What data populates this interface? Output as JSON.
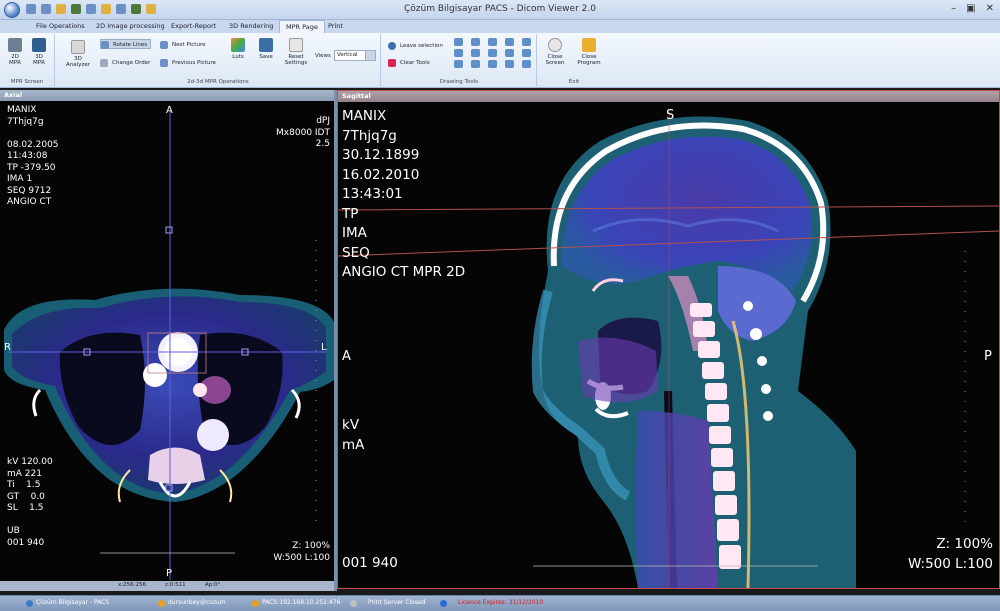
{
  "window": {
    "title": "Çözüm Bilgisayar PACS - Dicom Viewer 2.0"
  },
  "tabs": [
    "File Operations",
    "2D Image processing",
    "Export-Report",
    "3D Rendering",
    "MPR Page",
    "Print"
  ],
  "active_tab": "MPR Page",
  "ribbon": {
    "mpr_screen": {
      "label": "MPR Screen",
      "btn_2d": "2D\nMPR",
      "btn_3d": "3D\nMPR"
    },
    "ops": {
      "label": "2d-3d MPR Operations",
      "analyzer": "3D\nAnalyzer",
      "rotate_lines": "Rotate Lines",
      "change_order": "Change Order",
      "next_picture": "Next Picture",
      "previous_picture": "Previous Picture",
      "luts": "Luts",
      "save": "Save",
      "reset_settings": "Reset\nSettings",
      "views_label": "Views",
      "views_value": "Vertical"
    },
    "drawing": {
      "label": "Drawing Tools",
      "leave_selection": "Leave selection",
      "clear_tools": "Clear Tools"
    },
    "exit": {
      "label": "Exit",
      "close_screen": "Close\nScreen",
      "close_program": "Close\nProgram"
    }
  },
  "axial": {
    "title": "Axial",
    "top_left": "MANIX\n7Thjq7g\n\n08.02.2005\n11:43:08\nTP -379.50\nIMA 1\nSEQ 9712\nANGIO CT",
    "top_right": "dPJ\nMx8000 IDT\n2.5",
    "bottom_left": "kV 120.00\nmA 221\nTi    1.5\nGT    0.0\nSL    1.5\n\nUB\n001 940",
    "bottom_right": "Z: 100%\nW:500 L:100",
    "orient_top": "A",
    "orient_bottom": "P",
    "orient_left": "R",
    "orient_right": "L",
    "coords": {
      "xy": "x:256:256",
      "z": "z:0:511",
      "ap": "Ap:0°"
    }
  },
  "sagittal": {
    "title": "Sagittal",
    "top_left": "MANIX\n7Thjq7g\n30.12.1899\n16.02.2010\n13:43:01\nTP\nIMA\nSEQ\nANGIO CT MPR 2D",
    "mid_left": "kV\nmA",
    "bottom_left": "001 940",
    "bottom_right": "Z: 100%\nW:500 L:100",
    "orient_top": "S",
    "orient_left": "A",
    "orient_right": "P"
  },
  "status": {
    "app": "Çözüm Bilgisayar - PACS",
    "user": "dursunbey@cozum",
    "pacs": "PACS:192.168.10.251:476",
    "print_server": "Print Server Closed",
    "warning": "Licence Expires: 31/12/2010"
  }
}
